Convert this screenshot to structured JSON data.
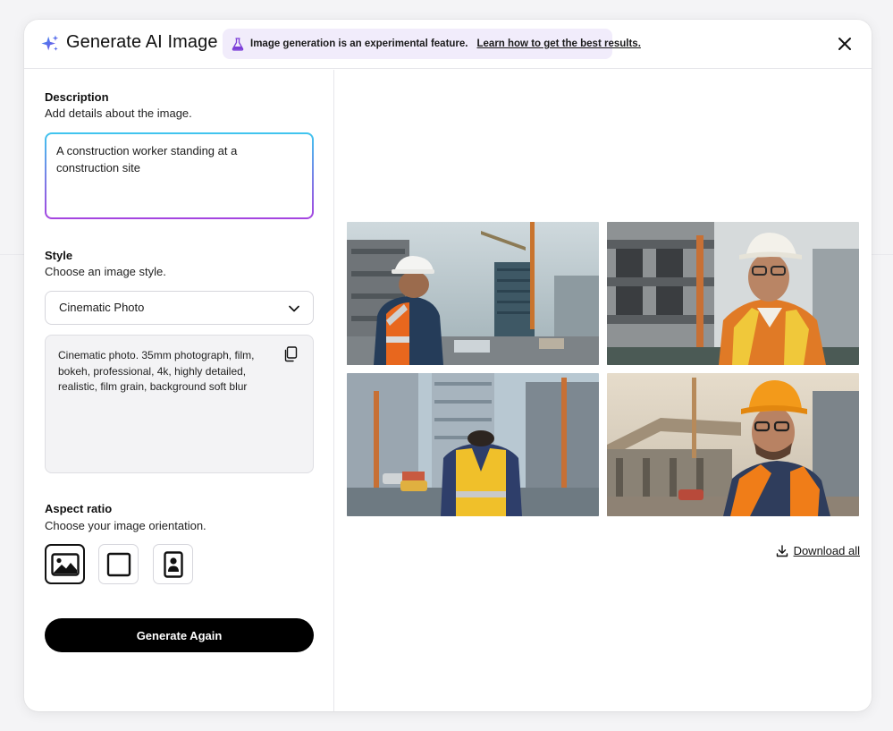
{
  "header": {
    "title": "Generate AI Image",
    "banner_text": "Image generation is an experimental feature.",
    "banner_link": "Learn how to get the best results."
  },
  "description": {
    "title": "Description",
    "subtitle": "Add details about the image.",
    "value": "A construction worker standing at a construction site"
  },
  "style": {
    "title": "Style",
    "subtitle": "Choose an image style.",
    "selected": "Cinematic Photo",
    "prompt": "Cinematic photo. 35mm photograph, film, bokeh, professional, 4k, highly detailed, realistic, film grain, background soft blur"
  },
  "aspect": {
    "title": "Aspect ratio",
    "subtitle": "Choose your image orientation.",
    "options": [
      "landscape",
      "square",
      "portrait"
    ],
    "selected": "landscape"
  },
  "actions": {
    "generate_label": "Generate Again",
    "download_label": "Download all"
  },
  "results": {
    "images": [
      {
        "icon": "photo-worker-back-white-helmet"
      },
      {
        "icon": "photo-worker-smiling-white-helmet"
      },
      {
        "icon": "photo-worker-back-yellow-vest"
      },
      {
        "icon": "photo-worker-orange-helmet"
      }
    ]
  },
  "colors": {
    "accent_gradient_start": "#3fc6ef",
    "accent_gradient_end": "#a544e0",
    "banner_bg": "#f1ecfb",
    "button_bg": "#000000"
  }
}
